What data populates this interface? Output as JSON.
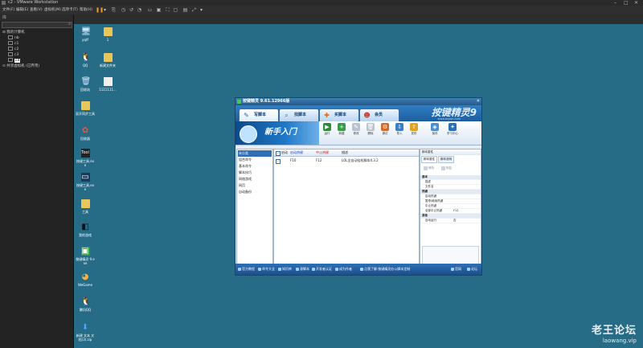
{
  "window": {
    "title": "c2 - VMware Workstation"
  },
  "menu": [
    "文件(F)",
    "编辑(E)",
    "查看(V)",
    "虚拟机(M)",
    "选项卡(T)",
    "帮助(H)"
  ],
  "sidebar": {
    "title": "库",
    "search_placeholder": "在此处键入内容进行搜索",
    "tree": [
      {
        "label": "我的计算机",
        "indent": 0
      },
      {
        "label": "nb",
        "indent": 1
      },
      {
        "label": "c1",
        "indent": 1
      },
      {
        "label": "c2",
        "indent": 1
      },
      {
        "label": "c3",
        "indent": 1
      },
      {
        "label": "c4",
        "indent": 1,
        "selected": true
      },
      {
        "label": "共享虚拟机 (已弃用)",
        "indent": 0
      }
    ]
  },
  "desktop_icons": [
    {
      "label": "yqtf",
      "kind": "pc"
    },
    {
      "label": "1",
      "kind": "folder"
    },
    {
      "label": "QQ",
      "kind": "qq"
    },
    {
      "label": "新建文件夹",
      "kind": "folder"
    },
    {
      "label": "回收站",
      "kind": "bin"
    },
    {
      "label": "1111111...",
      "kind": "file"
    },
    {
      "label": "双开同步工具",
      "kind": "folder"
    },
    {
      "label": "回收器",
      "kind": "app"
    },
    {
      "label": "按键工具.exe",
      "kind": "tool"
    },
    {
      "label": "按键工具.exe",
      "kind": "tool"
    },
    {
      "label": "工具",
      "kind": "folder"
    },
    {
      "label": "我的游戏",
      "kind": "app"
    },
    {
      "label": "按键精灵 9.exe",
      "kind": "app"
    },
    {
      "label": "WeGame",
      "kind": "app"
    },
    {
      "label": "腾讯QQ",
      "kind": "qq"
    },
    {
      "label": "新建 文本 文档(3).zip",
      "kind": "file"
    }
  ],
  "app": {
    "title": "按键精灵 9.61.12966版",
    "close": "✕",
    "tabs": [
      "写脚本",
      "找脚本",
      "买脚本",
      "会员"
    ],
    "brand": "按键精灵9",
    "brand_sub": "www.anjian.com",
    "banner": "新手入门",
    "tools": [
      "运行",
      "新建",
      "修改",
      "删除",
      "调试",
      "导入",
      "发布",
      "保存",
      "学习中心"
    ],
    "left_list": [
      "未分类",
      "组合命令",
      "基本命令",
      "脚本技巧",
      "网络游戏",
      "网页",
      "自动备份"
    ],
    "table": {
      "headers": [
        "启动",
        "启动热键",
        "中止热键",
        "描述"
      ],
      "rows": [
        {
          "checked": true,
          "start": "F10",
          "stop": "F12",
          "desc": "LOL全自动挂机脚本4.3.2"
        }
      ]
    },
    "props": {
      "title": "脚本属性",
      "tabs": [
        "脚本属性",
        "脚本说明"
      ],
      "buttons": [
        "修改",
        "恢复"
      ],
      "rows": [
        {
          "cat": true,
          "k": "基本"
        },
        {
          "k": "描述",
          "v": ""
        },
        {
          "k": "文件名",
          "v": ""
        },
        {
          "cat": true,
          "k": "热键"
        },
        {
          "k": "启动热键",
          "v": ""
        },
        {
          "k": "暂停/继续热键",
          "v": ""
        },
        {
          "k": "中止热键",
          "v": ""
        },
        {
          "k": "全部中止热键",
          "v": "F12"
        },
        {
          "cat": true,
          "k": "其他"
        },
        {
          "k": "自动运行",
          "v": "否"
        }
      ]
    },
    "bottom_links": [
      "官方教程",
      "命令大全",
      "知识库",
      "源脚本",
      "开发者认证",
      "成为作者",
      "点我了解·按键精灵办公脚本定制"
    ],
    "bottom_right": [
      "官网",
      "论坛"
    ]
  },
  "watermark": {
    "line1": "老王论坛",
    "line2": "laowang.vip"
  }
}
